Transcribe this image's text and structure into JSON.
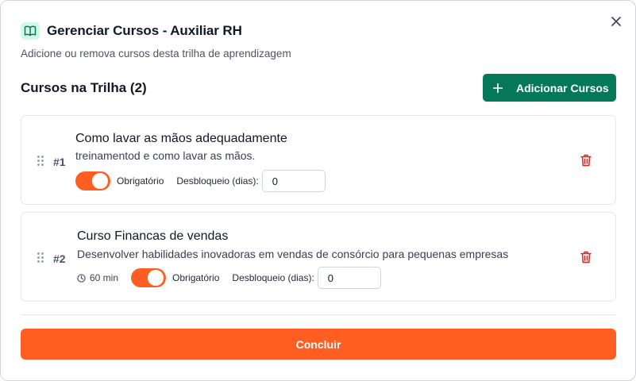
{
  "dialog": {
    "title": "Gerenciar Cursos - Auxiliar RH",
    "subtitle": "Adicione ou remova cursos desta trilha de aprendizagem",
    "icon": "book-open-icon",
    "close_icon": "close-icon"
  },
  "section": {
    "title": "Cursos na Trilha (2)",
    "add_button_label": "Adicionar Cursos"
  },
  "courses": [
    {
      "order": "#1",
      "title": "Como lavar as mãos adequadamente",
      "description": "treinamentod e como lavar as mãos.",
      "duration": "",
      "required": true,
      "required_label": "Obrigatório",
      "unlock_label": "Desbloqueio (dias):",
      "unlock_days": "0"
    },
    {
      "order": "#2",
      "title": "Curso Financas de vendas",
      "description": "Desenvolver habilidades inovadoras em vendas de consórcio para pequenas empresas",
      "duration": "60 min",
      "required": true,
      "required_label": "Obrigatório",
      "unlock_label": "Desbloqueio (dias):",
      "unlock_days": "0"
    }
  ],
  "footer": {
    "done_label": "Concluir"
  },
  "colors": {
    "primary_green": "#047857",
    "accent_orange": "#ff5e23",
    "danger_red": "#dc2626"
  }
}
